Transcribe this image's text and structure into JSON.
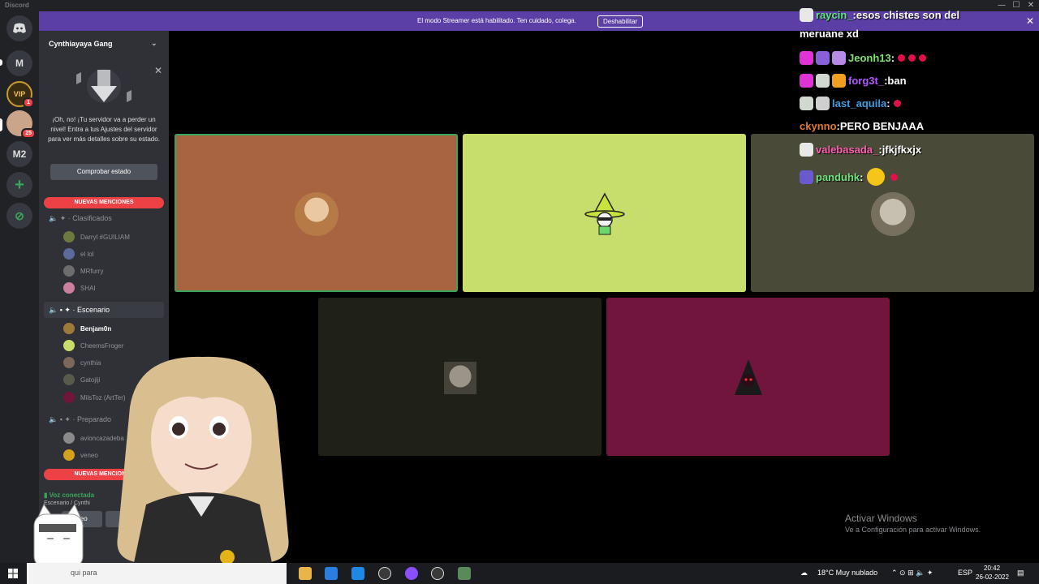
{
  "titlebar": {
    "app_name": "Discord",
    "min": "—",
    "max": "☐",
    "close": "✕"
  },
  "servers": [
    {
      "label": "M"
    },
    {
      "label": "VIP",
      "badge": "1"
    },
    {
      "badge": "25"
    },
    {
      "label": "M2"
    },
    {
      "label": "+"
    },
    {
      "label": "⊘"
    }
  ],
  "banner": {
    "message": "El modo Streamer está habilitado. Ten cuidado, colega.",
    "button": "Deshabilitar",
    "close": "✕"
  },
  "sidebar": {
    "server_name": "Cynthiayaya Gang",
    "boost": {
      "text": "¡Oh, no! ¡Tu servidor va a perder un nivel! Entra a tus Ajustes del servidor para ver más detalles sobre su estado.",
      "button": "Comprobar estado"
    },
    "new_mentions": "NUEVAS MENCIONES",
    "channels": [
      {
        "name": "Clasificados",
        "users": [
          "Darryl #GUILIAM",
          "el lol",
          "MRfurry",
          "SHAI"
        ]
      },
      {
        "name": "Escenario",
        "users": [
          "Benjam0n",
          "CheemsFroger",
          "cynthia",
          "Gatojiji",
          "MilsToz (ArtTer)"
        ]
      },
      {
        "name": "Preparado",
        "users": [
          "avioncazadeba",
          "veneo"
        ]
      }
    ],
    "voice": {
      "status": "Voz conectada",
      "sub": "Escenario / Cynthi",
      "video": "deo"
    }
  },
  "tiles": [
    {
      "color": "#a86440"
    },
    {
      "color": "#c8de6c"
    },
    {
      "color": "#494a38"
    },
    {
      "color": "#1f2117"
    },
    {
      "color": "#72153d"
    }
  ],
  "chat": [
    {
      "user": "raycin_",
      "msg": "esos chistes son del",
      "color": "#5ee87a"
    },
    {
      "user": "",
      "msg": "meruane xd",
      "color": "#ffffff"
    },
    {
      "user": "Jeonh13",
      "msg": "",
      "color": "#7fe36e"
    },
    {
      "user": "forg3t_",
      "msg": "ban",
      "color": "#b259ff"
    },
    {
      "user": "last_aquila",
      "msg": "",
      "color": "#3f9de0"
    },
    {
      "user": "ckynno",
      "msg": "PERO BENJAAA",
      "color": "#e0792e"
    },
    {
      "user": "valebasada_",
      "msg": "jfkjfkxjx",
      "color": "#ff5fb0"
    },
    {
      "user": "panduhk",
      "msg": "",
      "color": "#6fe07a"
    }
  ],
  "watermark": {
    "title": "Activar Windows",
    "sub": "Ve a Configuración para activar Windows."
  },
  "taskbar": {
    "search": "qui para",
    "weather": "18°C  Muy nublado",
    "lang": "ESP",
    "time": "20:42",
    "date": "26-02-2022"
  }
}
